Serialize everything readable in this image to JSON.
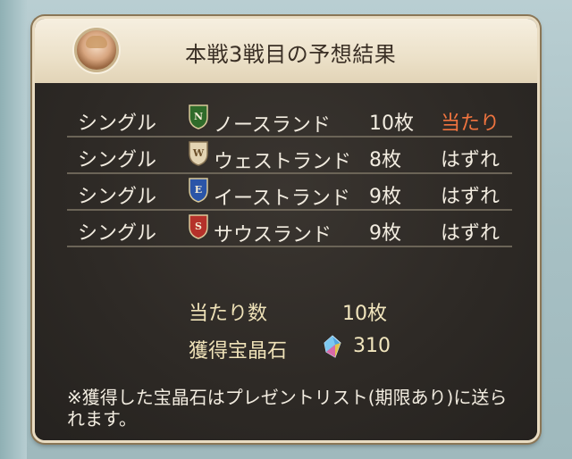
{
  "dialog": {
    "title": "本戦3戦目の予想結果"
  },
  "results": [
    {
      "type": "シングル",
      "badge_letter": "N",
      "badge_color": "#2f6b2a",
      "team": "ノースランド",
      "count": "10枚",
      "result": "当たり",
      "win": true
    },
    {
      "type": "シングル",
      "badge_letter": "W",
      "badge_color": "#d8c8a8",
      "team": "ウェストランド",
      "count": "8枚",
      "result": "はずれ",
      "win": false
    },
    {
      "type": "シングル",
      "badge_letter": "E",
      "badge_color": "#2a55a8",
      "team": "イーストランド",
      "count": "9枚",
      "result": "はずれ",
      "win": false
    },
    {
      "type": "シングル",
      "badge_letter": "S",
      "badge_color": "#b5312a",
      "team": "サウスランド",
      "count": "9枚",
      "result": "はずれ",
      "win": false
    }
  ],
  "summary": {
    "hits_label": "当たり数",
    "hits_value": "10枚",
    "reward_label": "獲得宝晶石",
    "reward_value": "310"
  },
  "footnote": "※獲得した宝晶石はプレゼントリスト(期限あり)に送られます。",
  "colors": {
    "win": "#f0743f",
    "panel": "#2e2a26",
    "header": "#ece1c9"
  }
}
